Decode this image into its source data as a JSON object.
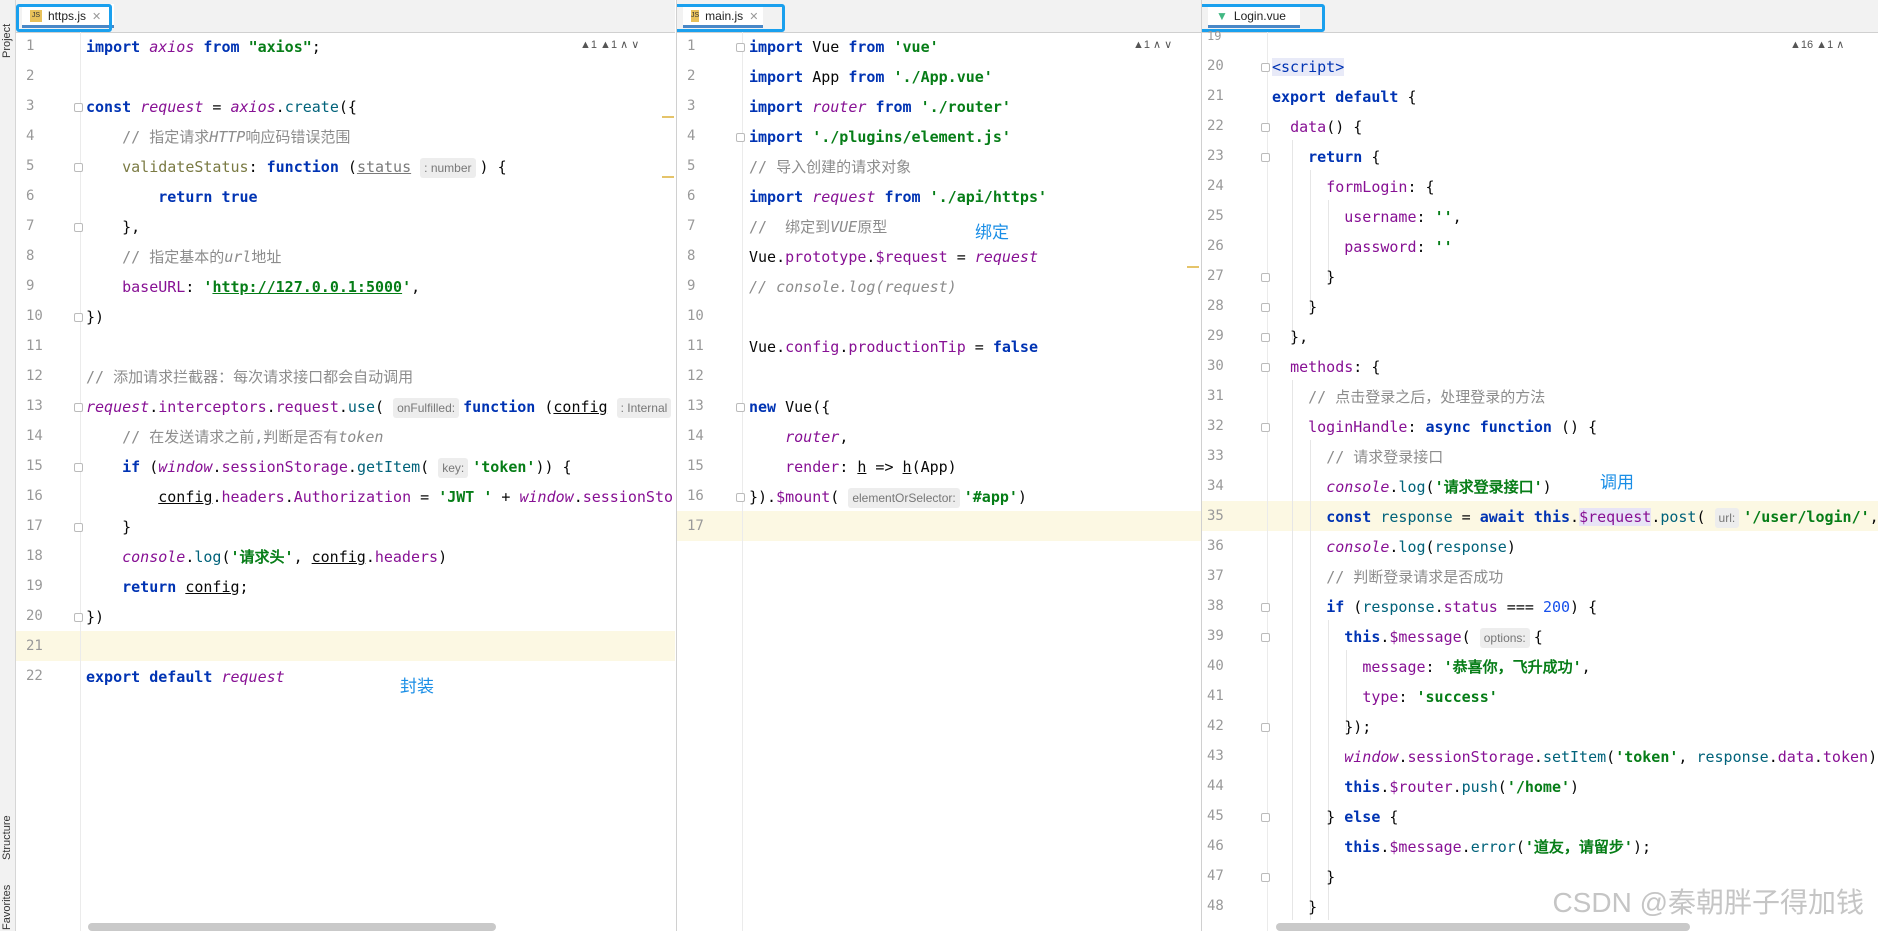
{
  "sidebar": {
    "project": "Project",
    "structure": "Structure",
    "favorites": "Favorites"
  },
  "panes": [
    {
      "tab": "https.js",
      "icon": "js-file-icon",
      "warnings": "▲1  ▲1  ∧  ∨",
      "annotation": "封装",
      "start": 1,
      "current_line": 21
    },
    {
      "tab": "main.js",
      "icon": "js-file-icon",
      "warnings": "▲1  ∧  ∨",
      "annotation": "绑定",
      "start": 1,
      "current_line": 17
    },
    {
      "tab": "Login.vue",
      "icon": "vue-file-icon",
      "warnings": "▲16  ▲1  ∧",
      "annotation": "调用",
      "start": 19,
      "current_line": 35
    }
  ],
  "watermark": "CSDN @秦朝胖子得加钱",
  "colors": {
    "highlight_box": "#1aa0ee",
    "keyword": "#0033b3",
    "string": "#067d17",
    "comment": "#8c8c8c",
    "property": "#871094",
    "number": "#1750eb"
  }
}
